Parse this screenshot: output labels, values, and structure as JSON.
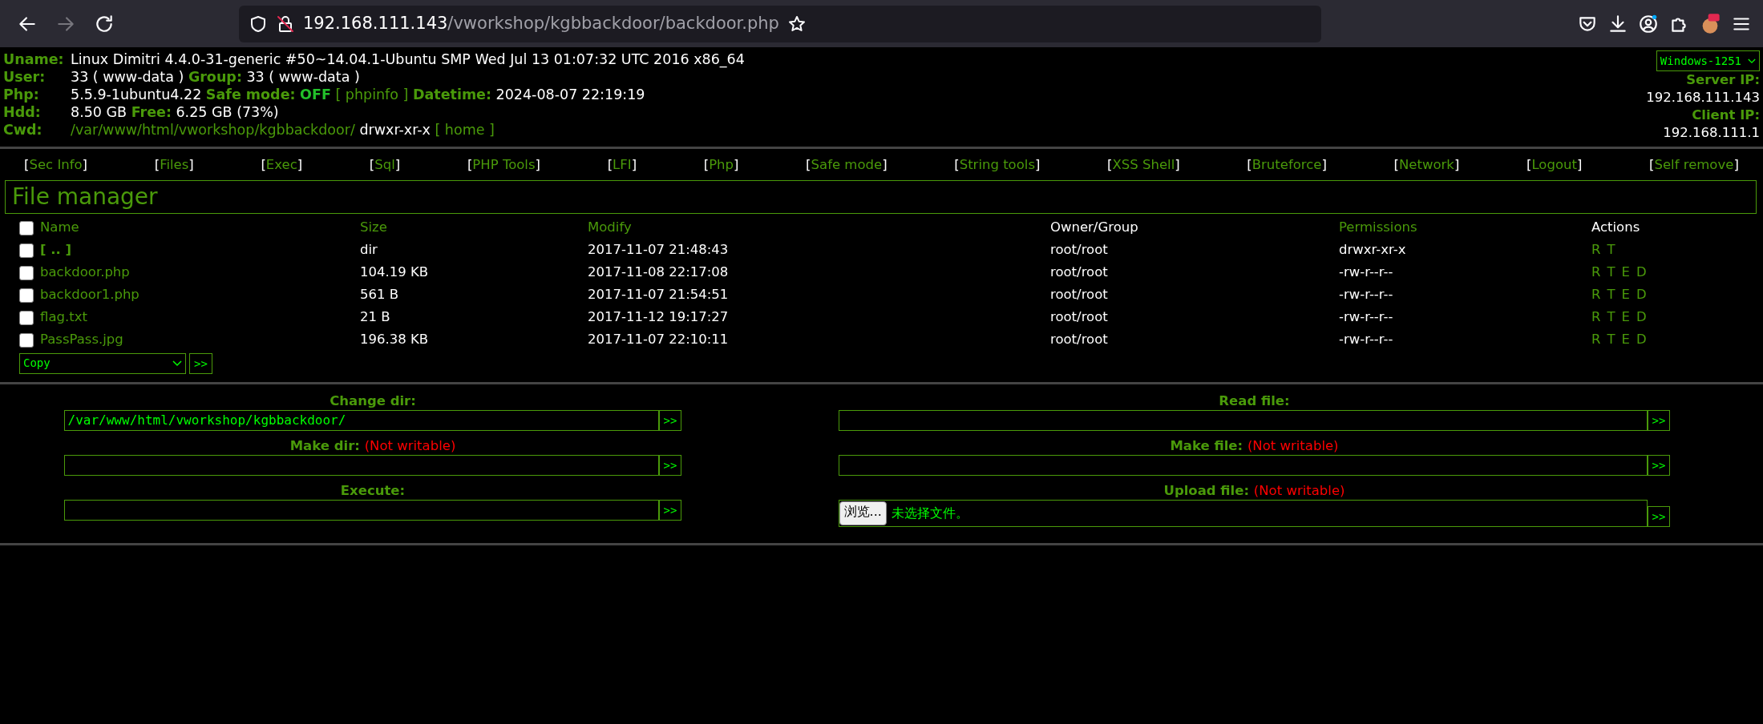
{
  "browser": {
    "url_host": "192.168.111.143",
    "url_path": "/vworkshop/kgbbackdoor/backdoor.php",
    "forward_disabled": true
  },
  "info": {
    "lines": [
      {
        "label": "Uname:",
        "parts": [
          {
            "kind": "value",
            "text": "Linux Dimitri 4.4.0-31-generic #50~14.04.1-Ubuntu SMP Wed Jul 13 01:07:32 UTC 2016 x86_64"
          }
        ]
      },
      {
        "label": "User:",
        "parts": [
          {
            "kind": "value",
            "text": "33 ( www-data )"
          },
          {
            "kind": "label",
            "text": "Group:"
          },
          {
            "kind": "value",
            "text": "33 ( www-data )"
          }
        ]
      },
      {
        "label": "Php:",
        "parts": [
          {
            "kind": "value",
            "text": "5.5.9-1ubuntu4.22"
          },
          {
            "kind": "label",
            "text": "Safe mode:"
          },
          {
            "kind": "alert",
            "text": "OFF"
          },
          {
            "kind": "link",
            "text": "[ phpinfo ]"
          },
          {
            "kind": "label",
            "text": "Datetime:"
          },
          {
            "kind": "value",
            "text": "2024-08-07 22:19:19"
          }
        ]
      },
      {
        "label": "Hdd:",
        "parts": [
          {
            "kind": "value",
            "text": "8.50 GB"
          },
          {
            "kind": "label",
            "text": "Free:"
          },
          {
            "kind": "value",
            "text": "6.25 GB (73%)"
          }
        ]
      },
      {
        "label": "Cwd:",
        "parts": [
          {
            "kind": "link",
            "text": "/var/www/html/vworkshop/kgbbackdoor/"
          },
          {
            "kind": "value",
            "text": "drwxr-xr-x"
          },
          {
            "kind": "link",
            "text": "[ home ]"
          }
        ]
      }
    ],
    "charset": "Windows-1251",
    "server_ip_label": "Server IP:",
    "server_ip": "192.168.111.143",
    "client_ip_label": "Client IP:",
    "client_ip": "192.168.111.1"
  },
  "nav": [
    {
      "left": "[",
      "label": "Sec Info",
      "right": "]"
    },
    {
      "left": "[",
      "label": "Files",
      "right": "]"
    },
    {
      "left": "[",
      "label": "Exec",
      "right": "]"
    },
    {
      "left": "[",
      "label": "Sql",
      "right": "]"
    },
    {
      "left": "[",
      "label": "PHP Tools",
      "right": "]"
    },
    {
      "left": "[",
      "label": "LFI",
      "right": "]"
    },
    {
      "left": "[",
      "label": "Php",
      "right": "]"
    },
    {
      "left": "[",
      "label": "Safe mode",
      "right": "]"
    },
    {
      "left": "[",
      "label": "String tools",
      "right": "]"
    },
    {
      "left": "[",
      "label": "XSS Shell",
      "right": "]"
    },
    {
      "left": "[",
      "label": "Bruteforce",
      "right": "]"
    },
    {
      "left": "[",
      "label": "Network",
      "right": "]"
    },
    {
      "left": "[",
      "label": "Logout",
      "right": "]"
    },
    {
      "left": "[",
      "label": "Self remove",
      "right": "]"
    }
  ],
  "title": "File manager",
  "table": {
    "select_all_checked": false,
    "columns": [
      {
        "label": "Name",
        "sortable": true
      },
      {
        "label": "Size",
        "sortable": true
      },
      {
        "label": "Modify",
        "sortable": true
      },
      {
        "label": "Owner/Group",
        "sortable": false
      },
      {
        "label": "Permissions",
        "sortable": true
      },
      {
        "label": "Actions",
        "sortable": false
      }
    ],
    "rows": [
      {
        "checked": false,
        "kind": "dir",
        "name": "[ .. ]",
        "size": "dir",
        "modify": "2017-11-07 21:48:43",
        "owner": "root/root",
        "perms": "drwxr-xr-x",
        "actions": [
          "R",
          "T"
        ]
      },
      {
        "checked": false,
        "kind": "file",
        "name": "backdoor.php",
        "size": "104.19 KB",
        "modify": "2017-11-08 22:17:08",
        "owner": "root/root",
        "perms": "-rw-r--r--",
        "actions": [
          "R",
          "T",
          "E",
          "D"
        ]
      },
      {
        "checked": false,
        "kind": "file",
        "name": "backdoor1.php",
        "size": "561 B",
        "modify": "2017-11-07 21:54:51",
        "owner": "root/root",
        "perms": "-rw-r--r--",
        "actions": [
          "R",
          "T",
          "E",
          "D"
        ]
      },
      {
        "checked": false,
        "kind": "file",
        "name": "flag.txt",
        "size": "21 B",
        "modify": "2017-11-12 19:17:27",
        "owner": "root/root",
        "perms": "-rw-r--r--",
        "actions": [
          "R",
          "T",
          "E",
          "D"
        ]
      },
      {
        "checked": false,
        "kind": "file",
        "name": "PassPass.jpg",
        "size": "196.38 KB",
        "modify": "2017-11-07 22:10:11",
        "owner": "root/root",
        "perms": "-rw-r--r--",
        "actions": [
          "R",
          "T",
          "E",
          "D"
        ]
      }
    ],
    "bulk_action": "Copy",
    "bulk_submit": ">>"
  },
  "forms": {
    "left": [
      {
        "kind": "text",
        "label": "Change dir:",
        "value": "/var/www/html/vworkshop/kgbbackdoor/",
        "button": ">>"
      },
      {
        "kind": "text",
        "label": "Make dir:",
        "note": "(Not writable)",
        "button": ">>"
      },
      {
        "kind": "text",
        "label": "Execute:",
        "button": ">>"
      }
    ],
    "right": [
      {
        "kind": "text",
        "label": "Read file:",
        "button": ">>"
      },
      {
        "kind": "text",
        "label": "Make file:",
        "note": "(Not writable)",
        "button": ">>"
      },
      {
        "kind": "file",
        "label": "Upload file:",
        "note": "(Not writable)",
        "browse": "浏览...",
        "file_status": "未选择文件。",
        "button": ">>"
      }
    ]
  }
}
